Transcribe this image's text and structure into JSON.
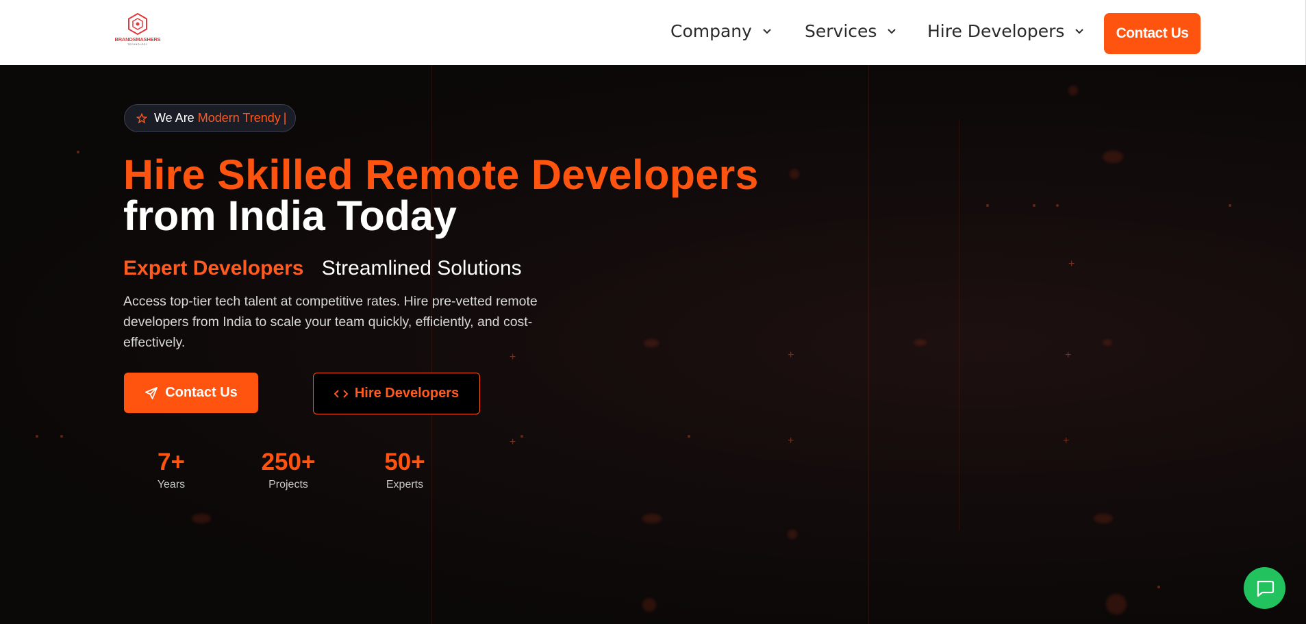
{
  "header": {
    "logo_text": "BRANDSMASHERS",
    "logo_sub": "TECHNOLOGY",
    "nav": [
      {
        "label": "Company"
      },
      {
        "label": "Services"
      },
      {
        "label": "Hire Developers"
      }
    ],
    "cta_label": "Contact Us"
  },
  "hero": {
    "badge_prefix": "We Are",
    "badge_accent": "Modern Trendy",
    "badge_caret": "|",
    "title_line1": "Hire Skilled Remote Developers",
    "title_line2": "from India Today",
    "sub_accent": "Expert Developers",
    "sub_plain": "Streamlined Solutions",
    "description": "Access top-tier tech talent at competitive rates. Hire pre-vetted remote developers from India to scale your team quickly, efficiently, and cost-effectively.",
    "primary_button": "Contact Us",
    "secondary_button": "Hire Developers",
    "stats": [
      {
        "value": "7+",
        "label": "Years"
      },
      {
        "value": "250+",
        "label": "Projects"
      },
      {
        "value": "50+",
        "label": "Experts"
      }
    ]
  },
  "icons": {
    "badge": "star-icon",
    "primary_button": "send-icon",
    "secondary_button": "code-icon",
    "chat": "chat-bubble-icon",
    "nav_dropdown": "chevron-down-icon"
  },
  "colors": {
    "accent": "#ff5410",
    "hero_background": "#0d0a0a",
    "chat_green": "#22c35e"
  }
}
